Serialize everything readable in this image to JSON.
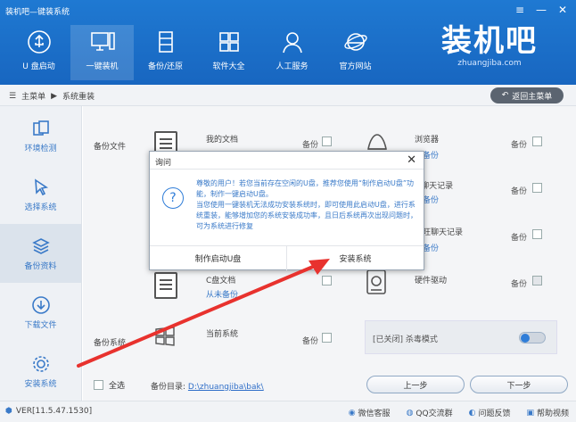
{
  "app": {
    "title": "装机吧—键装系统",
    "window_controls": [
      "≡",
      "—",
      "✕"
    ]
  },
  "nav": [
    {
      "label": "U 盘启动",
      "icon": "usb-icon"
    },
    {
      "label": "一键装机",
      "icon": "monitor-icon"
    },
    {
      "label": "备份/还原",
      "icon": "server-icon"
    },
    {
      "label": "软件大全",
      "icon": "grid-icon"
    },
    {
      "label": "人工服务",
      "icon": "person-icon"
    },
    {
      "label": "官方网站",
      "icon": "ie-icon"
    }
  ],
  "logo": {
    "main": "装机吧",
    "sub": "zhuangjiba.com"
  },
  "breadcrumb": {
    "root": "主菜单",
    "current": "系统重装",
    "back_label": "返回主菜单"
  },
  "sidebar": [
    {
      "label": "环境检测"
    },
    {
      "label": "选择系统"
    },
    {
      "label": "备份资料"
    },
    {
      "label": "下载文件"
    },
    {
      "label": "安装系统"
    }
  ],
  "backup": {
    "files_label": "备份文件",
    "system_label": "备份系统",
    "items_left": [
      {
        "name": "我的文档",
        "status": "",
        "check": "备份"
      },
      {
        "name": "",
        "status": "",
        "check": "备份"
      },
      {
        "name": "C盘文档",
        "status": "从未备份",
        "check": "备份"
      },
      {
        "name": "当前系统",
        "status": "",
        "check": "备份"
      }
    ],
    "items_right": [
      {
        "name": "浏览器",
        "status": "未备份",
        "check": "备份"
      },
      {
        "name": "Q聊天记录",
        "status": "未备份",
        "check": "备份"
      },
      {
        "name": "旺旺聊天记录",
        "status": "未备份",
        "check": "备份"
      },
      {
        "name": "硬件驱动",
        "status": "",
        "check": "备份"
      }
    ],
    "antivirus_label": "[已关闭] 杀毒模式"
  },
  "bottom": {
    "select_all": "全选",
    "dir_prefix": "备份目录:",
    "dir_path": "D:\\zhuangjiba\\bak\\",
    "prev": "上一步",
    "next": "下一步"
  },
  "status": {
    "version": "VER[11.5.47.1530]",
    "links": [
      "微信客服",
      "QQ交流群",
      "问题反馈",
      "帮助视频"
    ]
  },
  "dialog": {
    "title": "询问",
    "close": "✕",
    "icon": "?",
    "line1": "尊敬的用户！若您当前存在空闲的U盘，推荐您使用“制作启动U盘”功能，制作一键启动U盘。",
    "line2": "当您使用一键装机无法成功安装系统时，即可使用此启动U盘，进行系统重装，能够增加您的系统安装成功率，且日后系统再次出现问题时，可为系统进行修复",
    "btn_left": "制作启动U盘",
    "btn_right": "安装系统"
  }
}
